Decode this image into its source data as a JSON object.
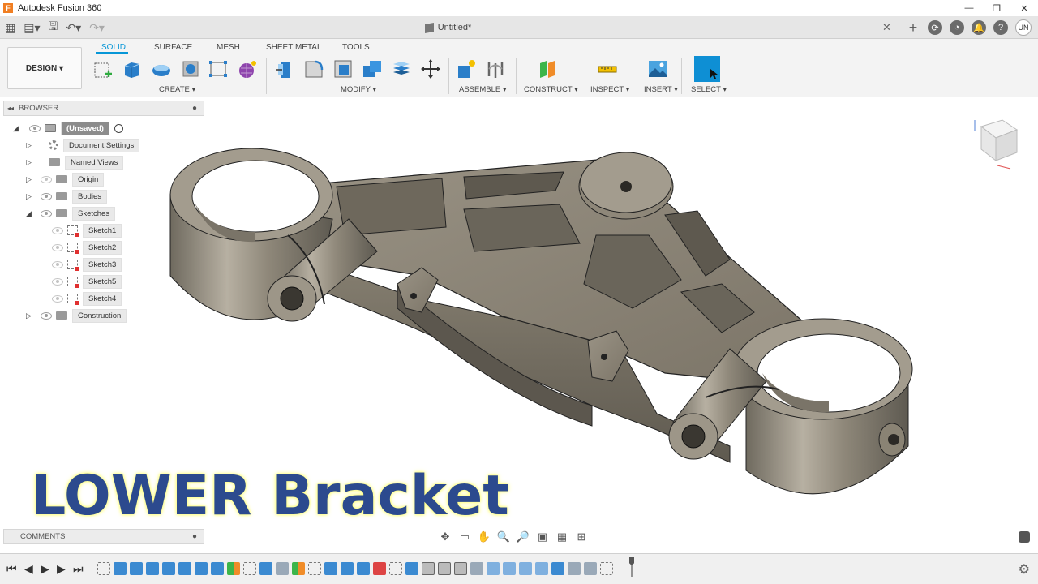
{
  "window": {
    "title": "Autodesk Fusion 360"
  },
  "document": {
    "tab_title": "Untitled*"
  },
  "user": {
    "initials": "UN"
  },
  "toolbar": {
    "workspace": "DESIGN ▾",
    "tabs": [
      "SOLID",
      "SURFACE",
      "MESH",
      "SHEET METAL",
      "TOOLS"
    ],
    "active_tab": "SOLID",
    "groups": {
      "create": "CREATE ▾",
      "modify": "MODIFY ▾",
      "assemble": "ASSEMBLE ▾",
      "construct": "CONSTRUCT ▾",
      "inspect": "INSPECT ▾",
      "insert": "INSERT ▾",
      "select": "SELECT ▾"
    }
  },
  "browser": {
    "header": "BROWSER",
    "root": "(Unsaved)",
    "items": [
      {
        "label": "Document Settings",
        "icon": "gear-icon"
      },
      {
        "label": "Named Views",
        "icon": "folder-icon"
      },
      {
        "label": "Origin",
        "icon": "folder-icon"
      },
      {
        "label": "Bodies",
        "icon": "folder-icon"
      },
      {
        "label": "Sketches",
        "icon": "folder-icon"
      },
      {
        "label": "Construction",
        "icon": "folder-icon"
      }
    ],
    "sketches": [
      "Sketch1",
      "Sketch2",
      "Sketch3",
      "Sketch5",
      "Sketch4"
    ]
  },
  "comments": {
    "header": "COMMENTS"
  },
  "viewport": {
    "overlay_title": "LOWER Bracket"
  },
  "colors": {
    "accent": "#0696d7",
    "overlay_text": "#2c4a8e",
    "model_body": "#8a8274"
  }
}
